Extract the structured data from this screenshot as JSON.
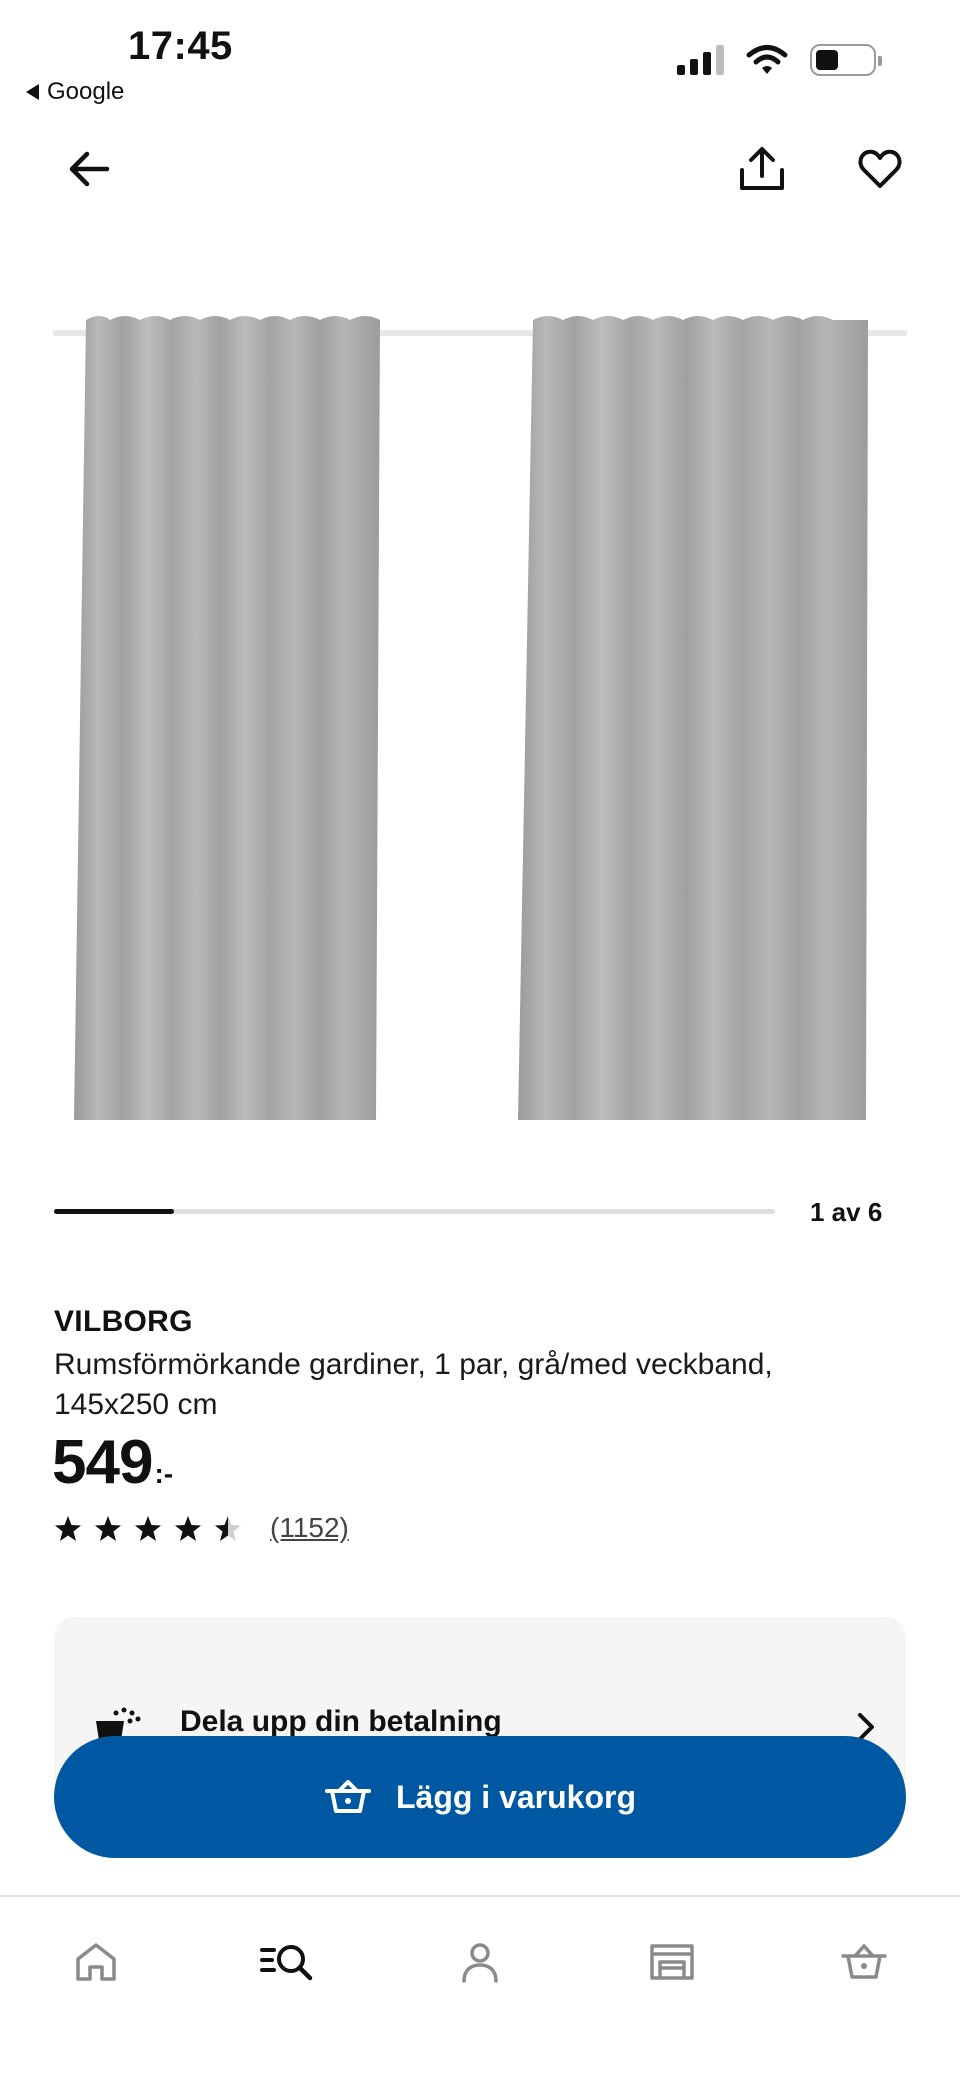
{
  "status_bar": {
    "time": "17:45",
    "back_app": "Google"
  },
  "icons": {
    "back": "arrow-left-icon",
    "share": "share-icon",
    "favorite": "heart-icon",
    "payment": "split-payment-icon",
    "cart": "basket-icon",
    "nav_home": "home-icon",
    "nav_search": "search-icon",
    "nav_profile": "profile-icon",
    "nav_stores": "store-icon",
    "nav_cart": "basket-icon"
  },
  "carousel": {
    "counter": "1 av 6",
    "current": 1,
    "total": 6
  },
  "product": {
    "name": "VILBORG",
    "description": "Rumsförmörkande gardiner, 1 par, grå/med veckband, 145x250 cm",
    "price_main": "549",
    "price_suffix": ":-",
    "rating": 4.5,
    "rating_max": 5,
    "review_count": "(1152)"
  },
  "payment": {
    "label": "Dela upp din betalning"
  },
  "add_to_cart": {
    "label": "Lägg i varukorg"
  },
  "colors": {
    "accent": "#0058a3",
    "curtain": "#a9a9a9",
    "card_bg": "#f5f5f5"
  }
}
